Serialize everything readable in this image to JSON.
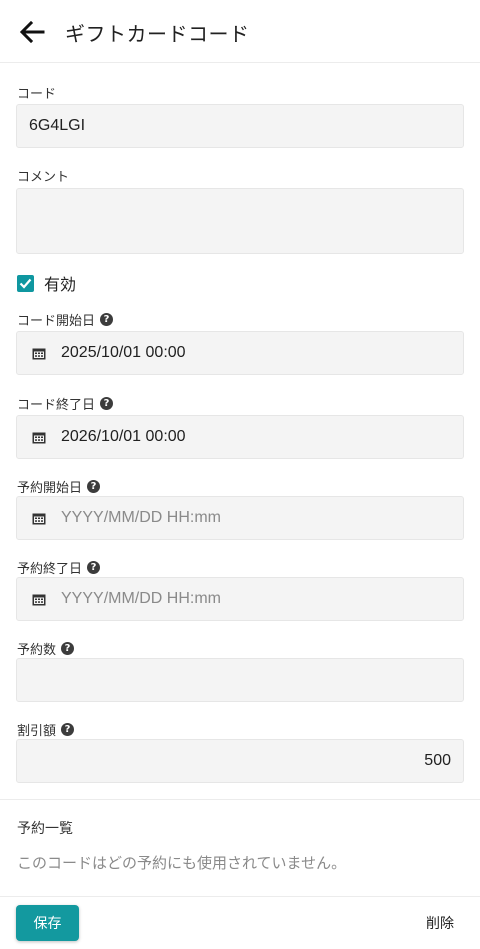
{
  "header": {
    "title": "ギフトカードコード"
  },
  "form": {
    "code": {
      "label": "コード",
      "value": "6G4LGI"
    },
    "comment": {
      "label": "コメント",
      "value": ""
    },
    "active": {
      "label": "有効",
      "checked": true
    },
    "code_start": {
      "label": "コード開始日",
      "value": "2025/10/01 00:00"
    },
    "code_end": {
      "label": "コード終了日",
      "value": "2026/10/01 00:00"
    },
    "reserve_start": {
      "label": "予約開始日",
      "placeholder": "YYYY/MM/DD HH:mm"
    },
    "reserve_end": {
      "label": "予約終了日",
      "placeholder": "YYYY/MM/DD HH:mm"
    },
    "reserve_count": {
      "label": "予約数",
      "value": ""
    },
    "discount": {
      "label": "割引額",
      "value": "500"
    }
  },
  "reservations": {
    "title": "予約一覧",
    "empty_message": "このコードはどの予約にも使用されていません。"
  },
  "footer": {
    "save_label": "保存",
    "delete_label": "削除"
  },
  "colors": {
    "accent": "#13999f"
  },
  "icons": {
    "back": "arrow-left-icon",
    "calendar": "calendar-icon",
    "help": "question-circle-icon",
    "check": "check-icon"
  }
}
